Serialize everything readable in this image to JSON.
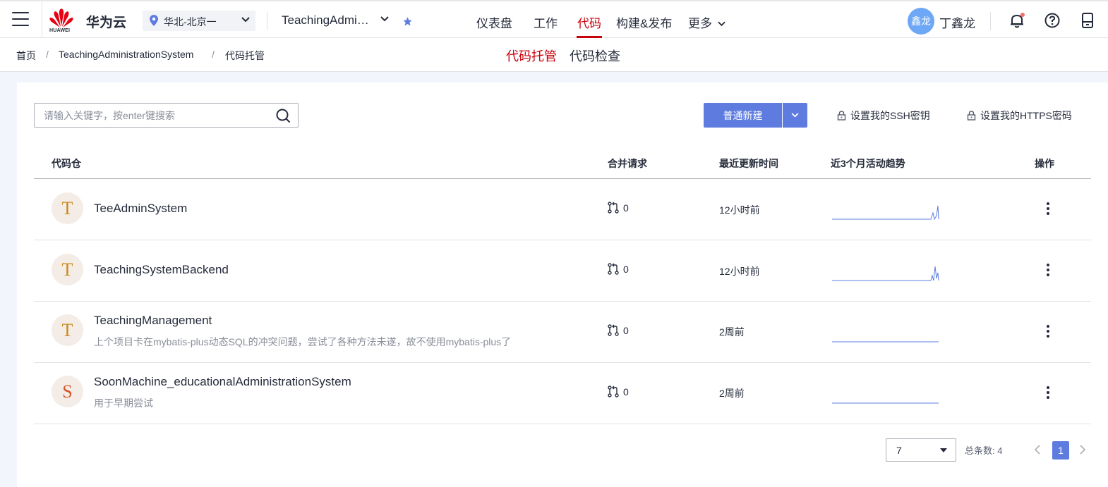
{
  "header": {
    "brand": "华为云",
    "logo_text": "HUAWEI",
    "region": "华北-北京一",
    "project": "TeachingAdministrationSystem",
    "nav": [
      "仪表盘",
      "工作",
      "代码",
      "构建&发布",
      "更多"
    ],
    "active_nav": "代码",
    "avatar_text": "鑫龙",
    "username": "丁鑫龙"
  },
  "breadcrumb": [
    "首页",
    "TeachingAdministrationSystem",
    "代码托管"
  ],
  "subtabs": [
    {
      "label": "代码托管",
      "active": true
    },
    {
      "label": "代码检查",
      "active": false
    }
  ],
  "toolbar": {
    "search_placeholder": "请输入关键字，按enter键搜索",
    "new_button": "普通新建",
    "ssh_link": "设置我的SSH密钥",
    "https_link": "设置我的HTTPS密码"
  },
  "table": {
    "headers": [
      "代码仓",
      "合并请求",
      "最近更新时间",
      "近3个月活动趋势",
      "操作"
    ],
    "rows": [
      {
        "initial": "T",
        "name": "TeeAdminSystem",
        "desc": "",
        "mr": "0",
        "updated": "12小时前",
        "trend_color": "#5e7ce0"
      },
      {
        "initial": "T",
        "name": "TeachingSystemBackend",
        "desc": "",
        "mr": "0",
        "updated": "12小时前",
        "trend_color": "#5e7ce0"
      },
      {
        "initial": "T",
        "name": "TeachingManagement",
        "desc": "上个项目卡在mybatis-plus动态SQL的冲突问题，尝试了各种方法未遂，故不使用mybatis-plus了",
        "mr": "0",
        "updated": "2周前",
        "trend_color": "#5e7ce0"
      },
      {
        "initial": "S",
        "name": "SoonMachine_educationalAdministrationSystem",
        "desc": "用于早期尝试",
        "mr": "0",
        "updated": "2周前",
        "trend_color": "#5e7ce0"
      }
    ]
  },
  "pagination": {
    "page_size": "7",
    "total": "总条数: 4",
    "current_page": "1"
  },
  "colors": {
    "accent": "#5e7ce0",
    "brand_red": "#c7000b",
    "initial_T": "#c98a1c",
    "initial_S": "#d9532a"
  }
}
